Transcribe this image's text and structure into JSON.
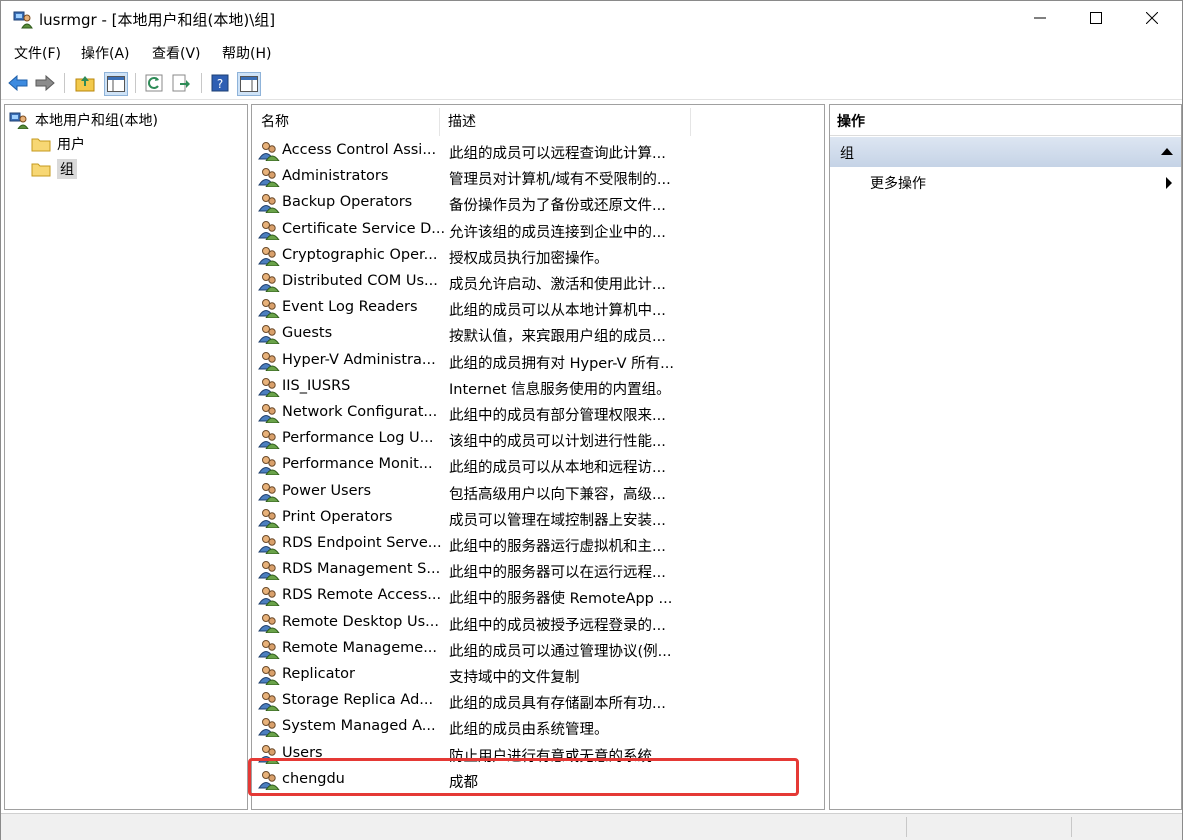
{
  "window": {
    "title": "lusrmgr - [本地用户和组(本地)\\组]"
  },
  "menu": [
    "文件(F)",
    "操作(A)",
    "查看(V)",
    "帮助(H)"
  ],
  "tree": {
    "root": "本地用户和组(本地)",
    "children": [
      "用户",
      "组"
    ],
    "selected": "组"
  },
  "list": {
    "columns": [
      "名称",
      "描述"
    ],
    "rows": [
      {
        "name": "Access Control Assi...",
        "desc": "此组的成员可以远程查询此计算..."
      },
      {
        "name": "Administrators",
        "desc": "管理员对计算机/域有不受限制的..."
      },
      {
        "name": "Backup Operators",
        "desc": "备份操作员为了备份或还原文件..."
      },
      {
        "name": "Certificate Service D...",
        "desc": "允许该组的成员连接到企业中的..."
      },
      {
        "name": "Cryptographic Oper...",
        "desc": "授权成员执行加密操作。"
      },
      {
        "name": "Distributed COM Us...",
        "desc": "成员允许启动、激活和使用此计..."
      },
      {
        "name": "Event Log Readers",
        "desc": "此组的成员可以从本地计算机中..."
      },
      {
        "name": "Guests",
        "desc": "按默认值，来宾跟用户组的成员..."
      },
      {
        "name": "Hyper-V Administra...",
        "desc": "此组的成员拥有对 Hyper-V 所有..."
      },
      {
        "name": "IIS_IUSRS",
        "desc": "Internet 信息服务使用的内置组。"
      },
      {
        "name": "Network Configurat...",
        "desc": "此组中的成员有部分管理权限来..."
      },
      {
        "name": "Performance Log U...",
        "desc": "该组中的成员可以计划进行性能..."
      },
      {
        "name": "Performance Monit...",
        "desc": "此组的成员可以从本地和远程访..."
      },
      {
        "name": "Power Users",
        "desc": "包括高级用户以向下兼容，高级..."
      },
      {
        "name": "Print Operators",
        "desc": "成员可以管理在域控制器上安装..."
      },
      {
        "name": "RDS Endpoint Serve...",
        "desc": "此组中的服务器运行虚拟机和主..."
      },
      {
        "name": "RDS Management S...",
        "desc": "此组中的服务器可以在运行远程..."
      },
      {
        "name": "RDS Remote Access...",
        "desc": "此组中的服务器使 RemoteApp ..."
      },
      {
        "name": "Remote Desktop Us...",
        "desc": "此组中的成员被授予远程登录的..."
      },
      {
        "name": "Remote Manageme...",
        "desc": "此组的成员可以通过管理协议(例..."
      },
      {
        "name": "Replicator",
        "desc": "支持域中的文件复制"
      },
      {
        "name": "Storage Replica Ad...",
        "desc": "此组的成员具有存储副本所有功..."
      },
      {
        "name": "System Managed A...",
        "desc": "此组的成员由系统管理。"
      },
      {
        "name": "Users",
        "desc": "防止用户进行有意或无意的系统..."
      },
      {
        "name": "chengdu",
        "desc": "成都"
      }
    ]
  },
  "actions": {
    "title": "操作",
    "group": "组",
    "more": "更多操作"
  },
  "icons": {
    "app": "lusrmgr-icon",
    "group": "user-group-icon",
    "folder": "folder-icon"
  },
  "colors": {
    "highlight": "#e53935",
    "action_group": "#c5d3e6"
  }
}
